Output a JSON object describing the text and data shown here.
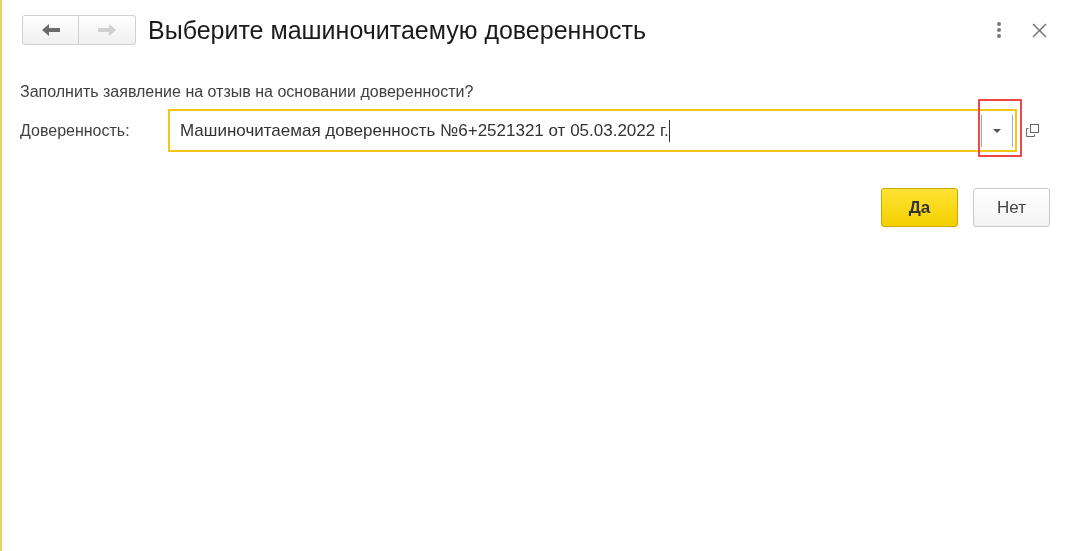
{
  "window": {
    "title": "Выберите машиночитаемую доверенность"
  },
  "nav": [
    {
      "kind": "back",
      "disabled": false
    },
    {
      "kind": "forward",
      "disabled": true
    }
  ],
  "question": "Заполнить заявление на отзыв на основании доверенности?",
  "field": {
    "label": "Доверенность:",
    "value": "Машиночитаемая доверенность №6+2521321 от 05.03.2022 г.",
    "focused": true,
    "dropdown_highlighted": true
  },
  "buttons": [
    {
      "label": "Да",
      "kind": "primary"
    },
    {
      "label": "Нет",
      "kind": "default"
    }
  ]
}
